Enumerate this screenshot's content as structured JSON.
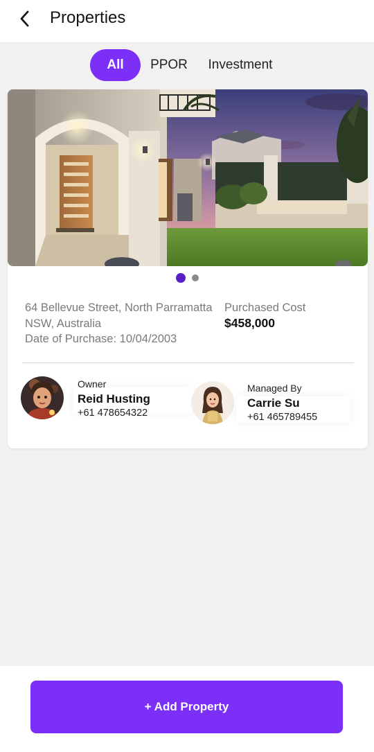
{
  "header": {
    "title": "Properties",
    "back_icon": "chevron-left-icon"
  },
  "filters": {
    "tabs": [
      "All",
      "PPOR",
      "Investment"
    ],
    "active": "All"
  },
  "property": {
    "photo": "house-exterior-photo",
    "carousel": {
      "count": 2,
      "active_index": 0
    },
    "address_line1": "64 Bellevue Street, North Parramatta",
    "address_line2": "NSW, Australia",
    "purchase_date": "Date of Purchase: 10/04/2003",
    "cost_label": "Purchased Cost",
    "cost_value": "$458,000",
    "owner": {
      "role": "Owner",
      "name": "Reid Husting",
      "phone": "+61 478654322"
    },
    "manager": {
      "role": "Managed By",
      "name": "Carrie Su",
      "phone": "+61 465789455"
    }
  },
  "footer": {
    "add_button": "+ Add Property"
  },
  "colors": {
    "accent": "#7b2ff7",
    "dot_active": "#5a1fc7",
    "dot_inactive": "#8a8a8a",
    "muted_text": "#7a7a7a",
    "background": "#f1f1f1"
  }
}
